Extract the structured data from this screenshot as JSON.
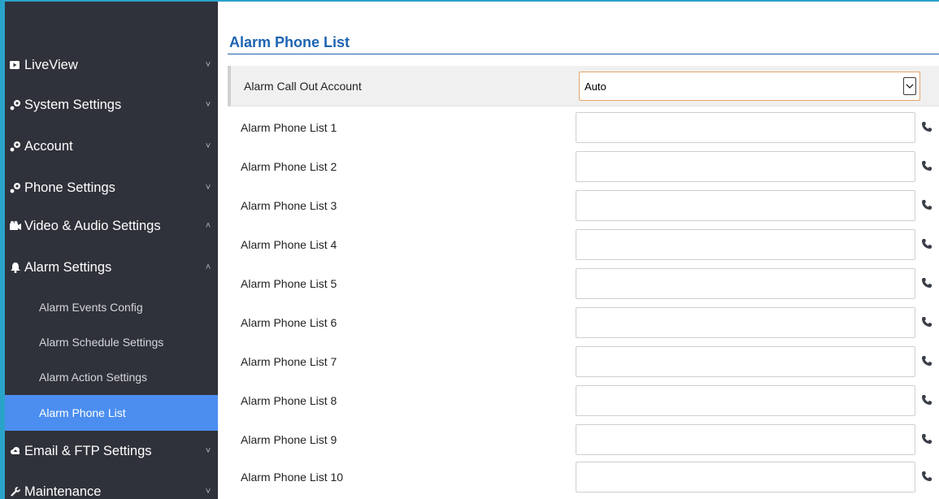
{
  "sidebar": {
    "items": [
      {
        "label": "LiveView",
        "icon": "video-icon",
        "chevron": "˅"
      },
      {
        "label": "System Settings",
        "icon": "settings-icon",
        "chevron": "˅"
      },
      {
        "label": "Account",
        "icon": "settings-icon",
        "chevron": "˅"
      },
      {
        "label": "Phone Settings",
        "icon": "settings-icon",
        "chevron": "˅"
      },
      {
        "label": "Video & Audio Settings",
        "icon": "camera-icon",
        "chevron": "˄"
      },
      {
        "label": "Alarm Settings",
        "icon": "bell-icon",
        "chevron": "˄"
      },
      {
        "label": "Email & FTP Settings",
        "icon": "cloud-icon",
        "chevron": "˅"
      },
      {
        "label": "Maintenance",
        "icon": "wrench-icon",
        "chevron": "˅"
      }
    ],
    "subitems": [
      {
        "label": "Alarm Events Config"
      },
      {
        "label": "Alarm Schedule Settings"
      },
      {
        "label": "Alarm Action Settings"
      },
      {
        "label": "Alarm Phone List",
        "active": true
      }
    ],
    "active_color": "#4b8ef0"
  },
  "main": {
    "title": "Alarm Phone List",
    "call_out": {
      "label": "Alarm Call Out Account",
      "value": "Auto"
    },
    "phone_lists": [
      {
        "label": "Alarm Phone List 1",
        "value": ""
      },
      {
        "label": "Alarm Phone List 2",
        "value": ""
      },
      {
        "label": "Alarm Phone List 3",
        "value": ""
      },
      {
        "label": "Alarm Phone List 4",
        "value": ""
      },
      {
        "label": "Alarm Phone List 5",
        "value": ""
      },
      {
        "label": "Alarm Phone List 6",
        "value": ""
      },
      {
        "label": "Alarm Phone List 7",
        "value": ""
      },
      {
        "label": "Alarm Phone List 8",
        "value": ""
      },
      {
        "label": "Alarm Phone List 9",
        "value": ""
      },
      {
        "label": "Alarm Phone List 10",
        "value": ""
      }
    ],
    "title_color": "#1d64b2"
  }
}
